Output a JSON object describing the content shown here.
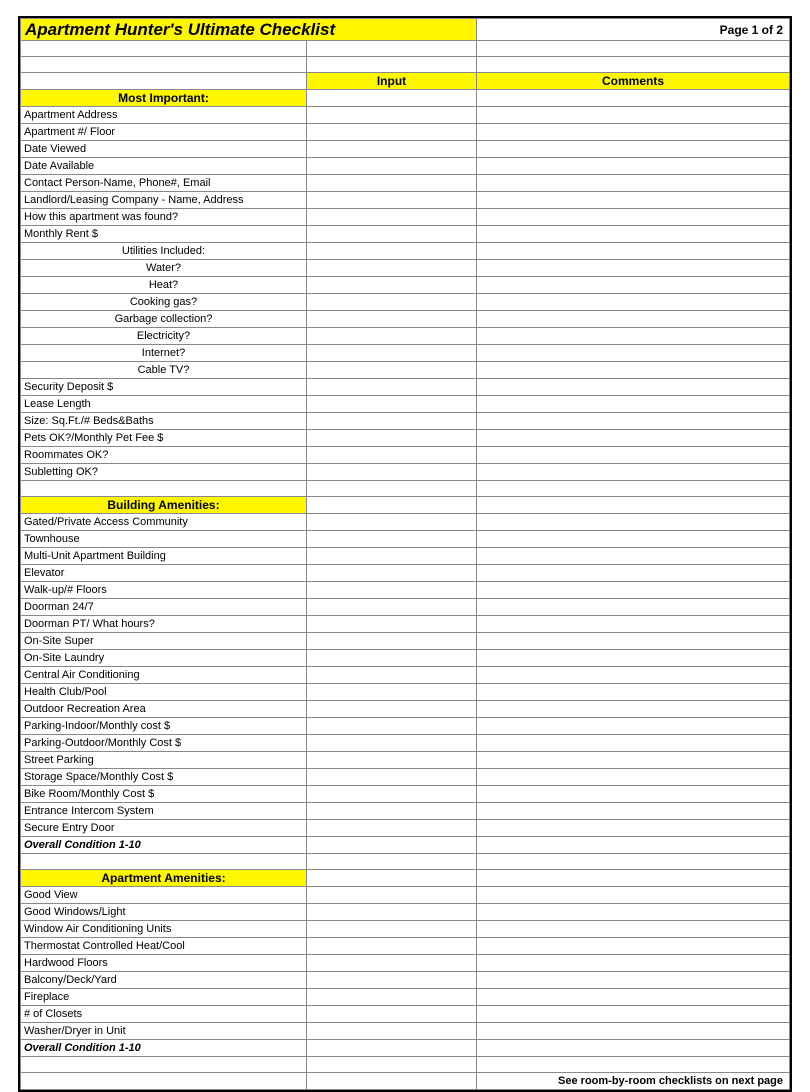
{
  "title": "Apartment Hunter's Ultimate Checklist",
  "page_number": "Page 1 of 2",
  "col_input": "Input",
  "col_comments": "Comments",
  "sections": {
    "most_important": {
      "header": "Most Important:",
      "rows": [
        {
          "label": "Apartment Address",
          "align": "left"
        },
        {
          "label": "Apartment #/ Floor",
          "align": "left"
        },
        {
          "label": "Date Viewed",
          "align": "left"
        },
        {
          "label": "Date Available",
          "align": "left"
        },
        {
          "label": "Contact Person-Name, Phone#, Email",
          "align": "left"
        },
        {
          "label": "Landlord/Leasing Company - Name, Address",
          "align": "left"
        },
        {
          "label": "How this apartment was found?",
          "align": "left"
        },
        {
          "label": "Monthly Rent $",
          "align": "left"
        },
        {
          "label": "Utilities Included:",
          "align": "center"
        },
        {
          "label": "Water?",
          "align": "center"
        },
        {
          "label": "Heat?",
          "align": "center"
        },
        {
          "label": "Cooking gas?",
          "align": "center"
        },
        {
          "label": "Garbage collection?",
          "align": "center"
        },
        {
          "label": "Electricity?",
          "align": "center"
        },
        {
          "label": "Internet?",
          "align": "center"
        },
        {
          "label": "Cable TV?",
          "align": "center"
        },
        {
          "label": "Security Deposit $",
          "align": "left"
        },
        {
          "label": "Lease Length",
          "align": "left"
        },
        {
          "label": "Size: Sq.Ft./# Beds&Baths",
          "align": "left"
        },
        {
          "label": "Pets OK?/Monthly Pet Fee $",
          "align": "left"
        },
        {
          "label": "Roommates OK?",
          "align": "left"
        },
        {
          "label": "Subletting OK?",
          "align": "left"
        }
      ]
    },
    "building_amenities": {
      "header": "Building Amenities:",
      "rows": [
        {
          "label": "Gated/Private Access Community",
          "align": "left"
        },
        {
          "label": "Townhouse",
          "align": "left"
        },
        {
          "label": "Multi-Unit Apartment Building",
          "align": "left"
        },
        {
          "label": "Elevator",
          "align": "left"
        },
        {
          "label": "Walk-up/# Floors",
          "align": "left"
        },
        {
          "label": "Doorman 24/7",
          "align": "left"
        },
        {
          "label": "Doorman PT/ What hours?",
          "align": "left"
        },
        {
          "label": "On-Site Super",
          "align": "left"
        },
        {
          "label": "On-Site Laundry",
          "align": "left"
        },
        {
          "label": "Central Air Conditioning",
          "align": "left"
        },
        {
          "label": "Health Club/Pool",
          "align": "left"
        },
        {
          "label": "Outdoor Recreation Area",
          "align": "left"
        },
        {
          "label": "Parking-Indoor/Monthly cost $",
          "align": "left"
        },
        {
          "label": "Parking-Outdoor/Monthly Cost $",
          "align": "left"
        },
        {
          "label": "Street Parking",
          "align": "left"
        },
        {
          "label": "Storage Space/Monthly Cost $",
          "align": "left"
        },
        {
          "label": "Bike Room/Monthly Cost $",
          "align": "left"
        },
        {
          "label": "Entrance Intercom System",
          "align": "left"
        },
        {
          "label": "Secure Entry Door",
          "align": "left"
        },
        {
          "label": "Overall Condition 1-10",
          "align": "left",
          "ital": true
        }
      ]
    },
    "apartment_amenities": {
      "header": "Apartment Amenities:",
      "rows": [
        {
          "label": "Good View",
          "align": "left"
        },
        {
          "label": "Good Windows/Light",
          "align": "left"
        },
        {
          "label": "Window Air Conditioning Units",
          "align": "left"
        },
        {
          "label": "Thermostat Controlled Heat/Cool",
          "align": "left"
        },
        {
          "label": "Hardwood Floors",
          "align": "left"
        },
        {
          "label": "Balcony/Deck/Yard",
          "align": "left"
        },
        {
          "label": "Fireplace",
          "align": "left"
        },
        {
          "label": "# of Closets",
          "align": "left"
        },
        {
          "label": "Washer/Dryer in Unit",
          "align": "left"
        },
        {
          "label": "Overall Condition 1-10",
          "align": "left",
          "ital": true
        }
      ]
    }
  },
  "footer_note": "See room-by-room checklists on next page"
}
